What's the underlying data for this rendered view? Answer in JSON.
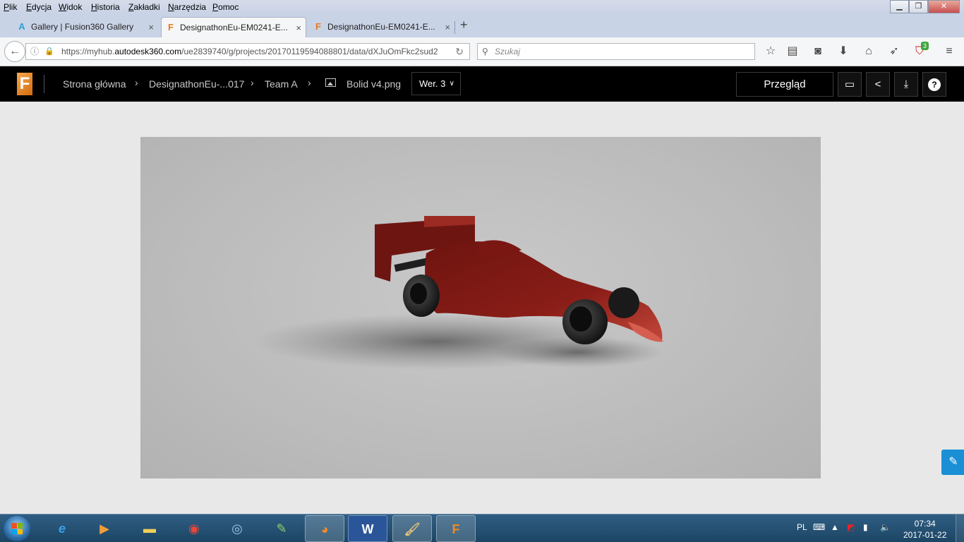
{
  "browser": {
    "menu": [
      "Plik",
      "Edycja",
      "Widok",
      "Historia",
      "Zakładki",
      "Narzędzia",
      "Pomoc"
    ],
    "tabs": [
      {
        "title": "Gallery | Fusion360 Gallery",
        "icon": "autodesk-a-icon"
      },
      {
        "title": "DesignathonEu-EM0241-E...",
        "icon": "fusion-f-icon"
      },
      {
        "title": "DesignathonEu-EM0241-E...",
        "icon": "fusion-f-icon"
      }
    ],
    "tab_close": "×",
    "new_tab": "+",
    "url_prefix": "https://myhub.",
    "url_domain": "autodesk360.com",
    "url_rest": "/ue2839740/g/projects/20170119594088801/data/dXJuOmFkc2sud2",
    "search_placeholder": "Szukaj",
    "addon_badge": "3"
  },
  "app": {
    "logo_letter": "F",
    "breadcrumbs": [
      "Strona główna",
      "DesignathonEu-...017",
      "Team A",
      "Bolid v4.png"
    ],
    "version": "Wer. 3",
    "review_button": "Przegląd"
  },
  "viewer": {
    "image_name": "Bolid v4.png",
    "car_color": "#8a1d17"
  },
  "taskbar": {
    "apps": [
      "Internet Explorer",
      "Media Player",
      "Explorer",
      "Chrome",
      "Cortana",
      "Notepad",
      "Firefox",
      "Word",
      "Paint",
      "Fusion 360"
    ],
    "word_letter": "W",
    "fusion_letter": "F",
    "lang": "PL",
    "time": "07:34",
    "date": "2017-01-22"
  }
}
